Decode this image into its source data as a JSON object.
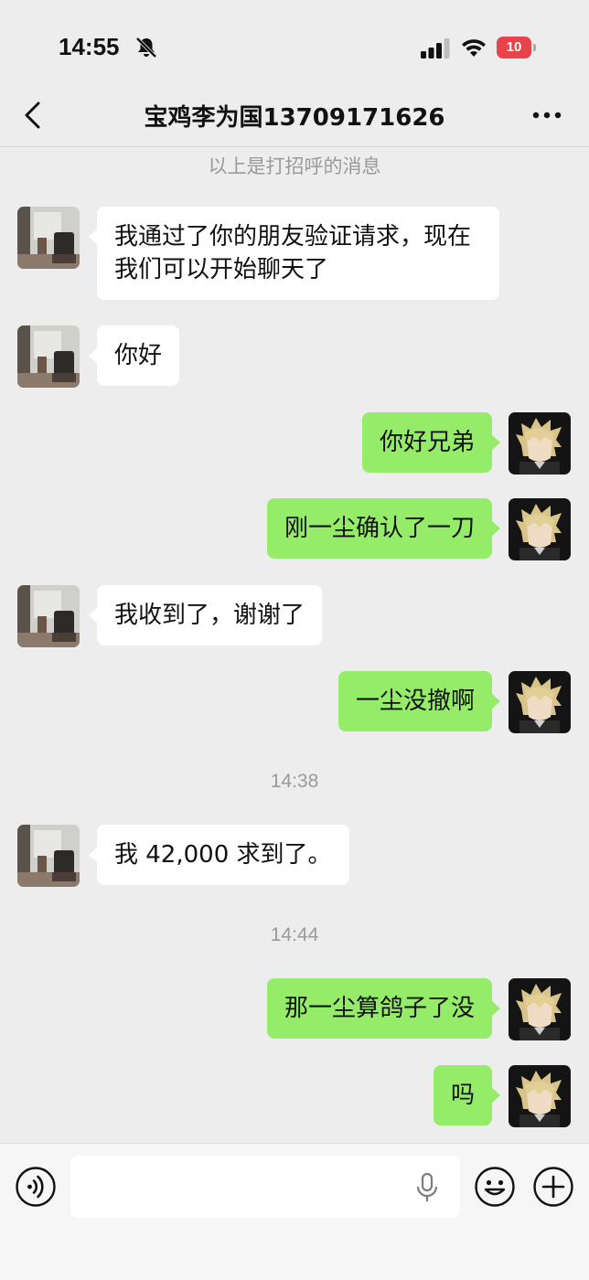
{
  "status_bar": {
    "time": "14:55",
    "battery": "10",
    "icons": [
      "bell-slash-icon",
      "signal-icon",
      "wifi-icon",
      "battery-icon"
    ],
    "battery_color": "#e8434b"
  },
  "header": {
    "title": "宝鸡李为国13709171626",
    "icons": [
      "back-chevron-icon",
      "more-dots-icon"
    ]
  },
  "chat": {
    "system_note": "以上是打招呼的消息",
    "messages": [
      {
        "from": "contact",
        "text": "我通过了你的朋友验证请求，现在我们可以开始聊天了"
      },
      {
        "from": "contact",
        "text": "你好"
      },
      {
        "from": "me",
        "text": "你好兄弟"
      },
      {
        "from": "me",
        "text": "刚一尘确认了一刀"
      },
      {
        "from": "contact",
        "text": "我收到了，谢谢了"
      },
      {
        "from": "me",
        "text": "一尘没撤啊"
      },
      {
        "from": "contact",
        "text": "我 42,000 求到了。"
      },
      {
        "from": "me",
        "text": "那一尘算鸽子了没"
      },
      {
        "from": "me",
        "text": "吗"
      }
    ],
    "timestamps": [
      "14:38",
      "14:44"
    ]
  },
  "input_bar": {
    "icons": [
      "voice-icon",
      "mic-icon",
      "emoji-icon",
      "plus-icon"
    ]
  },
  "colors": {
    "background": "#ededed",
    "outgoing_bubble": "#95ec69",
    "incoming_bubble": "#ffffff"
  }
}
